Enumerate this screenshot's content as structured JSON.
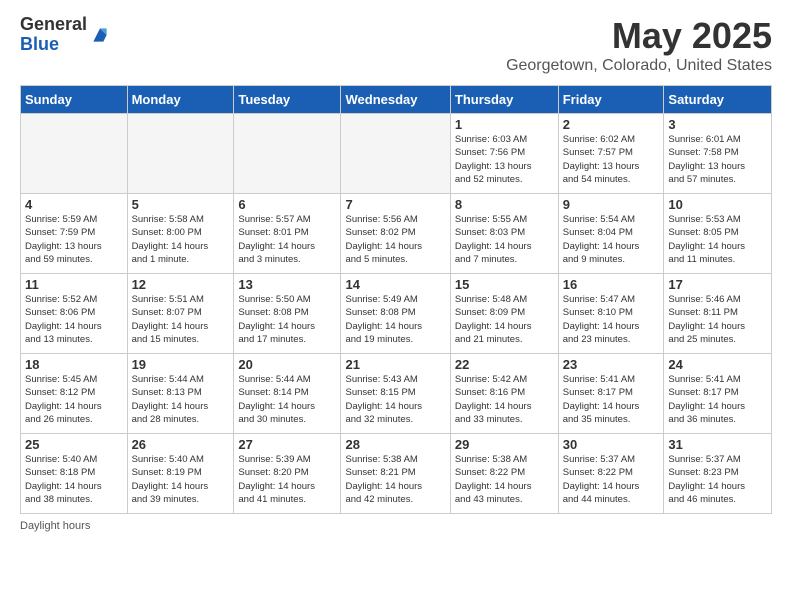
{
  "header": {
    "logo_general": "General",
    "logo_blue": "Blue",
    "main_title": "May 2025",
    "subtitle": "Georgetown, Colorado, United States"
  },
  "calendar": {
    "days_of_week": [
      "Sunday",
      "Monday",
      "Tuesday",
      "Wednesday",
      "Thursday",
      "Friday",
      "Saturday"
    ],
    "weeks": [
      [
        {
          "day": "",
          "info": ""
        },
        {
          "day": "",
          "info": ""
        },
        {
          "day": "",
          "info": ""
        },
        {
          "day": "",
          "info": ""
        },
        {
          "day": "1",
          "info": "Sunrise: 6:03 AM\nSunset: 7:56 PM\nDaylight: 13 hours\nand 52 minutes."
        },
        {
          "day": "2",
          "info": "Sunrise: 6:02 AM\nSunset: 7:57 PM\nDaylight: 13 hours\nand 54 minutes."
        },
        {
          "day": "3",
          "info": "Sunrise: 6:01 AM\nSunset: 7:58 PM\nDaylight: 13 hours\nand 57 minutes."
        }
      ],
      [
        {
          "day": "4",
          "info": "Sunrise: 5:59 AM\nSunset: 7:59 PM\nDaylight: 13 hours\nand 59 minutes."
        },
        {
          "day": "5",
          "info": "Sunrise: 5:58 AM\nSunset: 8:00 PM\nDaylight: 14 hours\nand 1 minute."
        },
        {
          "day": "6",
          "info": "Sunrise: 5:57 AM\nSunset: 8:01 PM\nDaylight: 14 hours\nand 3 minutes."
        },
        {
          "day": "7",
          "info": "Sunrise: 5:56 AM\nSunset: 8:02 PM\nDaylight: 14 hours\nand 5 minutes."
        },
        {
          "day": "8",
          "info": "Sunrise: 5:55 AM\nSunset: 8:03 PM\nDaylight: 14 hours\nand 7 minutes."
        },
        {
          "day": "9",
          "info": "Sunrise: 5:54 AM\nSunset: 8:04 PM\nDaylight: 14 hours\nand 9 minutes."
        },
        {
          "day": "10",
          "info": "Sunrise: 5:53 AM\nSunset: 8:05 PM\nDaylight: 14 hours\nand 11 minutes."
        }
      ],
      [
        {
          "day": "11",
          "info": "Sunrise: 5:52 AM\nSunset: 8:06 PM\nDaylight: 14 hours\nand 13 minutes."
        },
        {
          "day": "12",
          "info": "Sunrise: 5:51 AM\nSunset: 8:07 PM\nDaylight: 14 hours\nand 15 minutes."
        },
        {
          "day": "13",
          "info": "Sunrise: 5:50 AM\nSunset: 8:08 PM\nDaylight: 14 hours\nand 17 minutes."
        },
        {
          "day": "14",
          "info": "Sunrise: 5:49 AM\nSunset: 8:08 PM\nDaylight: 14 hours\nand 19 minutes."
        },
        {
          "day": "15",
          "info": "Sunrise: 5:48 AM\nSunset: 8:09 PM\nDaylight: 14 hours\nand 21 minutes."
        },
        {
          "day": "16",
          "info": "Sunrise: 5:47 AM\nSunset: 8:10 PM\nDaylight: 14 hours\nand 23 minutes."
        },
        {
          "day": "17",
          "info": "Sunrise: 5:46 AM\nSunset: 8:11 PM\nDaylight: 14 hours\nand 25 minutes."
        }
      ],
      [
        {
          "day": "18",
          "info": "Sunrise: 5:45 AM\nSunset: 8:12 PM\nDaylight: 14 hours\nand 26 minutes."
        },
        {
          "day": "19",
          "info": "Sunrise: 5:44 AM\nSunset: 8:13 PM\nDaylight: 14 hours\nand 28 minutes."
        },
        {
          "day": "20",
          "info": "Sunrise: 5:44 AM\nSunset: 8:14 PM\nDaylight: 14 hours\nand 30 minutes."
        },
        {
          "day": "21",
          "info": "Sunrise: 5:43 AM\nSunset: 8:15 PM\nDaylight: 14 hours\nand 32 minutes."
        },
        {
          "day": "22",
          "info": "Sunrise: 5:42 AM\nSunset: 8:16 PM\nDaylight: 14 hours\nand 33 minutes."
        },
        {
          "day": "23",
          "info": "Sunrise: 5:41 AM\nSunset: 8:17 PM\nDaylight: 14 hours\nand 35 minutes."
        },
        {
          "day": "24",
          "info": "Sunrise: 5:41 AM\nSunset: 8:17 PM\nDaylight: 14 hours\nand 36 minutes."
        }
      ],
      [
        {
          "day": "25",
          "info": "Sunrise: 5:40 AM\nSunset: 8:18 PM\nDaylight: 14 hours\nand 38 minutes."
        },
        {
          "day": "26",
          "info": "Sunrise: 5:40 AM\nSunset: 8:19 PM\nDaylight: 14 hours\nand 39 minutes."
        },
        {
          "day": "27",
          "info": "Sunrise: 5:39 AM\nSunset: 8:20 PM\nDaylight: 14 hours\nand 41 minutes."
        },
        {
          "day": "28",
          "info": "Sunrise: 5:38 AM\nSunset: 8:21 PM\nDaylight: 14 hours\nand 42 minutes."
        },
        {
          "day": "29",
          "info": "Sunrise: 5:38 AM\nSunset: 8:22 PM\nDaylight: 14 hours\nand 43 minutes."
        },
        {
          "day": "30",
          "info": "Sunrise: 5:37 AM\nSunset: 8:22 PM\nDaylight: 14 hours\nand 44 minutes."
        },
        {
          "day": "31",
          "info": "Sunrise: 5:37 AM\nSunset: 8:23 PM\nDaylight: 14 hours\nand 46 minutes."
        }
      ]
    ]
  },
  "footer": {
    "daylight_hours": "Daylight hours"
  }
}
